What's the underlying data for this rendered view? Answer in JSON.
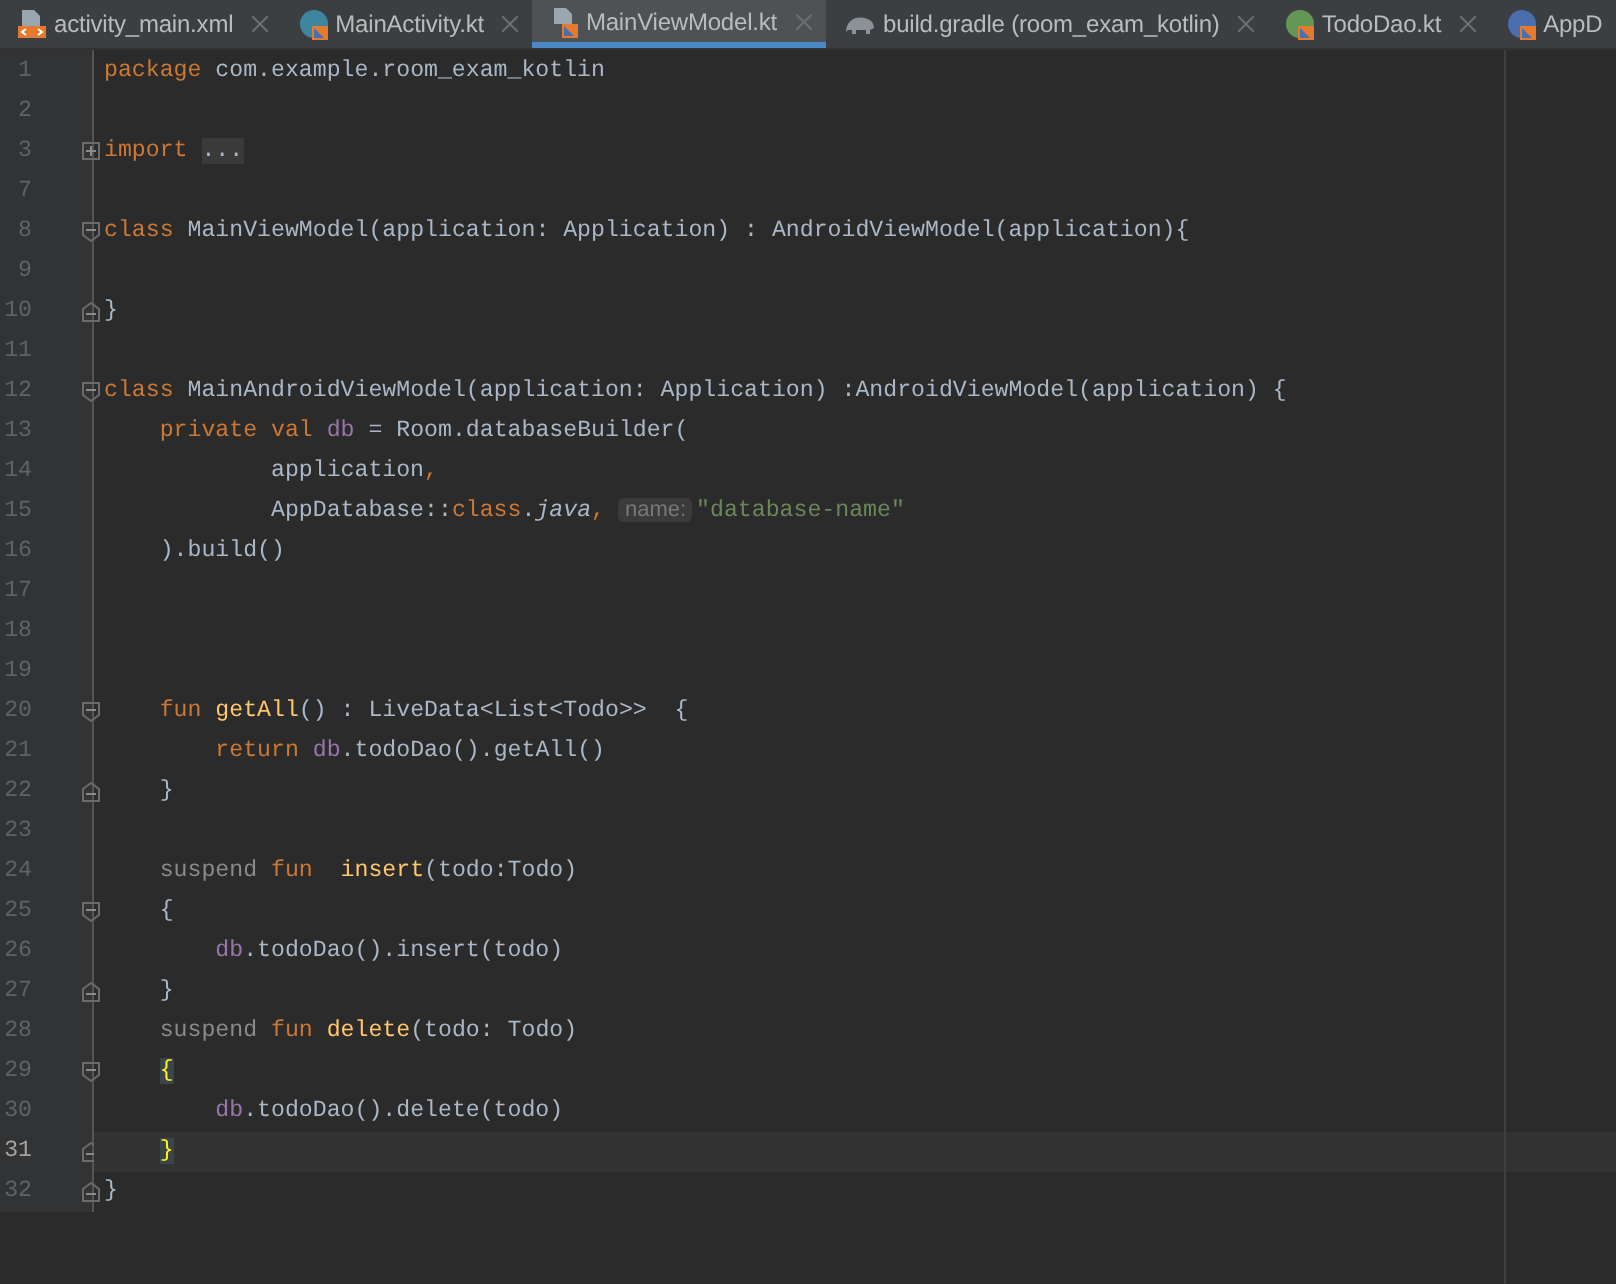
{
  "tabs": [
    {
      "label": "activity_main.xml",
      "kind": "xml",
      "selected": false
    },
    {
      "label": "MainActivity.kt",
      "kind": "activity",
      "selected": false
    },
    {
      "label": "MainViewModel.kt",
      "kind": "file",
      "selected": true
    },
    {
      "label": "build.gradle (room_exam_kotlin)",
      "kind": "gradle",
      "selected": false
    },
    {
      "label": "TodoDao.kt",
      "kind": "interface",
      "selected": false
    },
    {
      "label": "AppD",
      "kind": "class",
      "selected": false
    }
  ],
  "lines": [
    {
      "number": "1",
      "kind": "plain",
      "current": false,
      "tokens": [
        {
          "kind": "kw",
          "text": "package"
        },
        {
          "kind": "plain",
          "text": " com.example.room_exam_kotlin"
        }
      ]
    },
    {
      "number": "2",
      "kind": "plain",
      "current": false
    },
    {
      "number": "3",
      "kind": "collapsed",
      "current": false,
      "tokens": [
        {
          "kind": "kw",
          "text": "import "
        },
        {
          "kind": "folded",
          "text": "..."
        }
      ]
    },
    {
      "number": "7",
      "kind": "plain",
      "current": false
    },
    {
      "number": "8",
      "kind": "fold-start",
      "current": false,
      "tokens": [
        {
          "kind": "kw",
          "text": "class"
        },
        {
          "kind": "plain",
          "text": " MainViewModel(application: Application) : AndroidViewModel(application){"
        }
      ]
    },
    {
      "number": "9",
      "kind": "plain",
      "current": false
    },
    {
      "number": "10",
      "kind": "fold-end",
      "current": false,
      "tokens": [
        {
          "kind": "plain",
          "text": "}"
        }
      ]
    },
    {
      "number": "11",
      "kind": "plain",
      "current": false
    },
    {
      "number": "12",
      "kind": "fold-start",
      "current": false,
      "tokens": [
        {
          "kind": "kw",
          "text": "class"
        },
        {
          "kind": "plain",
          "text": " MainAndroidViewModel(application: Application) :AndroidViewModel(application) {"
        }
      ]
    },
    {
      "number": "13",
      "kind": "plain",
      "current": false,
      "tokens": [
        {
          "kind": "kw",
          "text": "    private val "
        },
        {
          "kind": "prop",
          "text": "db"
        },
        {
          "kind": "plain",
          "text": " = Room.databaseBuilder("
        }
      ]
    },
    {
      "number": "14",
      "kind": "plain",
      "current": false,
      "tokens": [
        {
          "kind": "plain",
          "text": "            application"
        },
        {
          "kind": "kw",
          "text": ","
        }
      ]
    },
    {
      "number": "15",
      "kind": "plain",
      "current": false,
      "tokens": [
        {
          "kind": "plain",
          "text": "            AppDatabase::"
        },
        {
          "kind": "kw",
          "text": "class"
        },
        {
          "kind": "plain",
          "text": "."
        },
        {
          "kind": "italic",
          "text": "java"
        },
        {
          "kind": "kw",
          "text": ", "
        },
        {
          "kind": "hint",
          "text": "name:"
        },
        {
          "kind": "str",
          "text": "\"database-name\""
        }
      ]
    },
    {
      "number": "16",
      "kind": "plain",
      "current": false,
      "tokens": [
        {
          "kind": "plain",
          "text": "    ).build()"
        }
      ]
    },
    {
      "number": "17",
      "kind": "plain",
      "current": false
    },
    {
      "number": "18",
      "kind": "plain",
      "current": false
    },
    {
      "number": "19",
      "kind": "plain",
      "current": false
    },
    {
      "number": "20",
      "kind": "fold-start",
      "current": false,
      "tokens": [
        {
          "kind": "kw",
          "text": "    fun "
        },
        {
          "kind": "fn",
          "text": "getAll"
        },
        {
          "kind": "plain",
          "text": "() : LiveData<List<Todo>>  {"
        }
      ]
    },
    {
      "number": "21",
      "kind": "plain",
      "current": false,
      "tokens": [
        {
          "kind": "kw",
          "text": "        return "
        },
        {
          "kind": "prop",
          "text": "db"
        },
        {
          "kind": "plain",
          "text": ".todoDao().getAll()"
        }
      ]
    },
    {
      "number": "22",
      "kind": "fold-end",
      "current": false,
      "tokens": [
        {
          "kind": "plain",
          "text": "    }"
        }
      ]
    },
    {
      "number": "23",
      "kind": "plain",
      "current": false
    },
    {
      "number": "24",
      "kind": "plain",
      "current": false,
      "tokens": [
        {
          "kind": "soft",
          "text": "    suspend "
        },
        {
          "kind": "kw",
          "text": "fun  "
        },
        {
          "kind": "fn",
          "text": "insert"
        },
        {
          "kind": "plain",
          "text": "(todo:Todo)"
        }
      ]
    },
    {
      "number": "25",
      "kind": "fold-start",
      "current": false,
      "tokens": [
        {
          "kind": "plain",
          "text": "    {"
        }
      ]
    },
    {
      "number": "26",
      "kind": "plain",
      "current": false,
      "tokens": [
        {
          "kind": "prop",
          "text": "        db"
        },
        {
          "kind": "plain",
          "text": ".todoDao().insert(todo)"
        }
      ]
    },
    {
      "number": "27",
      "kind": "fold-end",
      "current": false,
      "tokens": [
        {
          "kind": "plain",
          "text": "    }"
        }
      ]
    },
    {
      "number": "28",
      "kind": "plain",
      "current": false,
      "tokens": [
        {
          "kind": "soft",
          "text": "    suspend "
        },
        {
          "kind": "kw",
          "text": "fun "
        },
        {
          "kind": "fn",
          "text": "delete"
        },
        {
          "kind": "plain",
          "text": "(todo: Todo)"
        }
      ]
    },
    {
      "number": "29",
      "kind": "fold-start",
      "current": false,
      "tokens": [
        {
          "kind": "match",
          "text": "    {"
        }
      ]
    },
    {
      "number": "30",
      "kind": "plain",
      "current": false,
      "tokens": [
        {
          "kind": "prop",
          "text": "        db"
        },
        {
          "kind": "plain",
          "text": ".todoDao().delete(todo)"
        }
      ]
    },
    {
      "number": "31",
      "kind": "fold-end",
      "current": true,
      "tokens": [
        {
          "kind": "match",
          "text": "    }"
        }
      ]
    },
    {
      "number": "32",
      "kind": "fold-end",
      "current": false,
      "tokens": [
        {
          "kind": "plain",
          "text": "}"
        }
      ]
    }
  ]
}
